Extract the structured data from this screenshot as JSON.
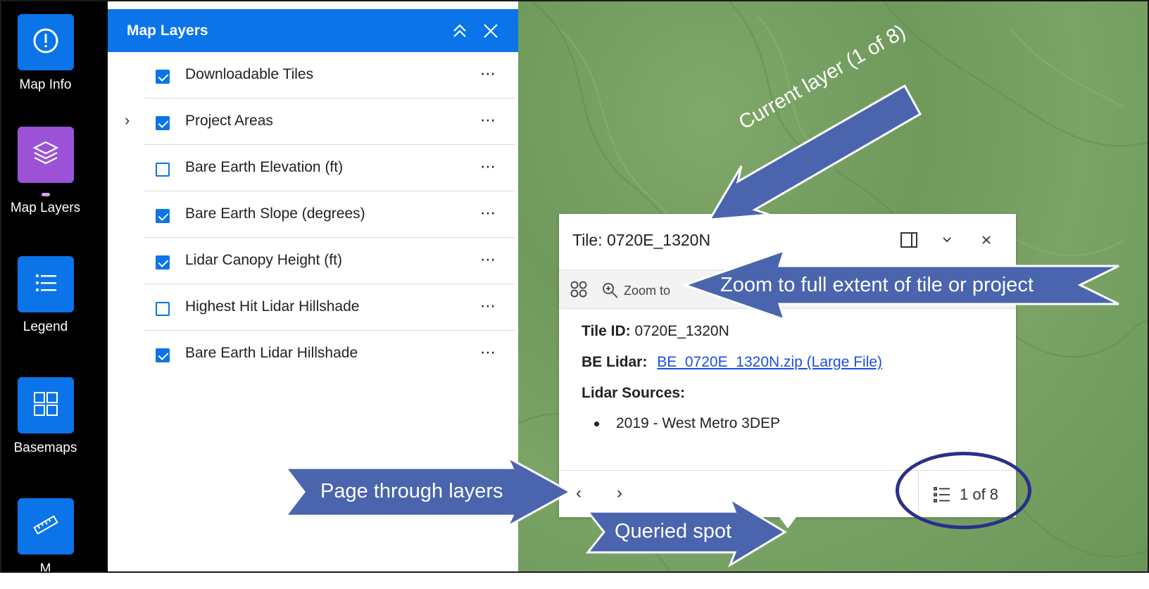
{
  "toolbar": {
    "items": [
      {
        "label": "Map Info",
        "icon": "info-icon"
      },
      {
        "label": "Map Layers",
        "icon": "layers-icon",
        "active": true
      },
      {
        "label": "Legend",
        "icon": "legend-icon"
      },
      {
        "label": "Basemaps",
        "icon": "basemaps-icon"
      },
      {
        "label": "M",
        "icon": "ruler-icon"
      }
    ]
  },
  "layers_panel": {
    "title": "Map Layers",
    "layers": [
      {
        "name": "Downloadable Tiles",
        "checked": true
      },
      {
        "name": "Project Areas",
        "checked": true,
        "expandable": true
      },
      {
        "name": "Bare Earth Elevation (ft)",
        "checked": false
      },
      {
        "name": "Bare Earth Slope (degrees)",
        "checked": true
      },
      {
        "name": "Lidar Canopy Height (ft)",
        "checked": true
      },
      {
        "name": "Highest Hit Lidar Hillshade",
        "checked": false
      },
      {
        "name": "Bare Earth Lidar Hillshade",
        "checked": true
      }
    ],
    "more_label": "⋯",
    "expand_label": "›"
  },
  "popup": {
    "title": "Tile: 0720E_1320N",
    "zoom_label": "Zoom to",
    "fields": {
      "tile_id_label": "Tile ID:",
      "tile_id_value": "0720E_1320N",
      "be_lidar_label": "BE Lidar:",
      "be_lidar_link": "BE_0720E_1320N.zip (Large File)",
      "sources_label": "Lidar Sources:",
      "sources": [
        "2019 - West Metro 3DEP"
      ]
    },
    "prev_label": "‹",
    "next_label": "›",
    "count_label": "1 of 8"
  },
  "callouts": {
    "current_layer": "Current layer (1 of 8)",
    "zoom_extent": "Zoom to full extent of tile or project",
    "page_through": "Page through layers",
    "queried_spot": "Queried spot",
    "arrow_color": "#4a64ad",
    "ring_color": "#2a2f8a"
  },
  "colors": {
    "accent": "#0a74e8",
    "active_tool": "#9b52d6",
    "map_green": "#78a264"
  }
}
